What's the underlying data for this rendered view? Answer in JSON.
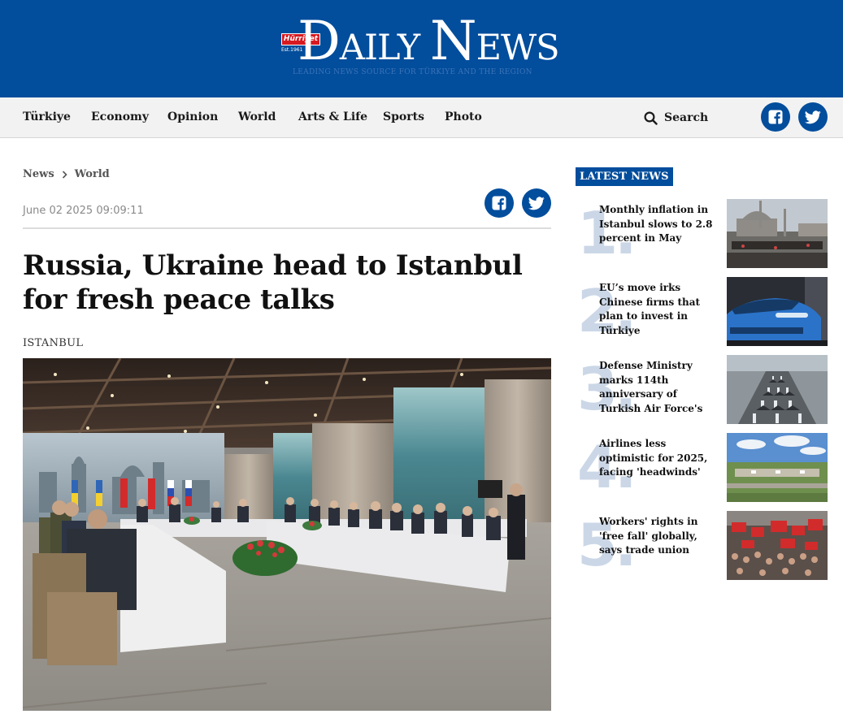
{
  "brand": {
    "badge": "Hürriyet",
    "established": "Est.1961",
    "name_first": "D",
    "name_first_rest": "AILY",
    "name_second": "N",
    "name_second_rest": "EWS",
    "tagline": "LEADING NEWS SOURCE FOR TÜRKIYE AND THE REGION",
    "primary_color": "#024d9c"
  },
  "nav": {
    "items": [
      "Türkiye",
      "Economy",
      "Opinion",
      "World",
      "Arts & Life",
      "Sports",
      "Photo"
    ],
    "search_label": "Search",
    "social": [
      "facebook-icon",
      "twitter-icon"
    ]
  },
  "article": {
    "breadcrumb": [
      "News",
      "World"
    ],
    "date": "June 02 2025 09:09:11",
    "title": "Russia, Ukraine head to Istanbul for fresh peace talks",
    "dateline": "ISTANBUL",
    "share": [
      "facebook-icon",
      "twitter-icon"
    ]
  },
  "latest": {
    "label": "LATEST NEWS",
    "items": [
      {
        "num": "1.",
        "title": "Monthly inflation in Istanbul slows to 2.8 percent in May"
      },
      {
        "num": "2.",
        "title": "EU’s move irks Chinese firms that plan to invest in Türkiye"
      },
      {
        "num": "3.",
        "title": "Defense Ministry marks 114th anniversary of Turkish Air Force's"
      },
      {
        "num": "4.",
        "title": "Airlines less optimistic for 2025, facing 'headwinds'"
      },
      {
        "num": "5.",
        "title": "Workers' rights in 'free fall' globally, says trade union"
      }
    ]
  }
}
